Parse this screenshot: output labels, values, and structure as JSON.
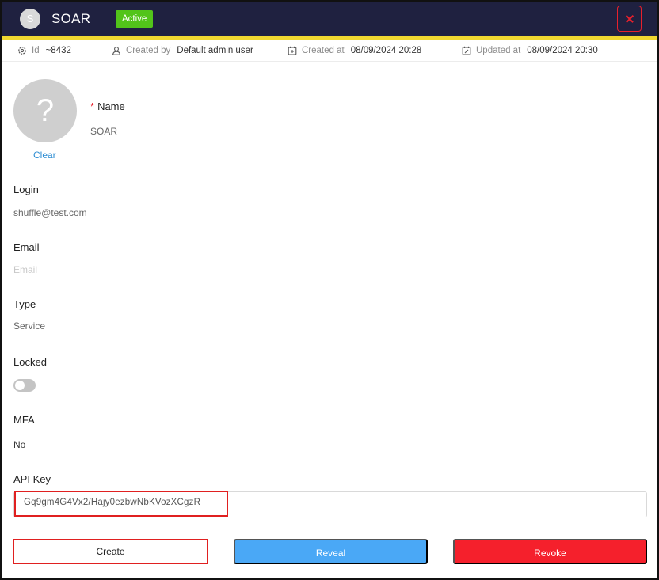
{
  "header": {
    "avatar_letter": "S",
    "title": "SOAR",
    "status": "Active",
    "close_icon": "close-icon",
    "colors": {
      "bar": "#1f2140",
      "stripe": "#f0d830",
      "status": "#52c41a",
      "close": "#e8202c"
    }
  },
  "meta": {
    "id_label": "Id",
    "id_value": "~8432",
    "created_by_label": "Created by",
    "created_by_value": "Default admin user",
    "created_at_label": "Created at",
    "created_at_value": "08/09/2024 20:28",
    "updated_at_label": "Updated at",
    "updated_at_value": "08/09/2024 20:30"
  },
  "avatar": {
    "placeholder": "?",
    "clear_label": "Clear"
  },
  "fields": {
    "name_label": "Name",
    "name_required": "*",
    "name_value": "SOAR",
    "login_label": "Login",
    "login_value": "shuffle@test.com",
    "email_label": "Email",
    "email_placeholder": "Email",
    "type_label": "Type",
    "type_value": "Service",
    "locked_label": "Locked",
    "locked_value": false,
    "mfa_label": "MFA",
    "mfa_value": "No",
    "api_key_label": "API Key",
    "api_key_value": "Gq9gm4G4Vx2/Hajy0ezbwNbKVozXCgzR"
  },
  "buttons": {
    "create": "Create",
    "reveal": "Reveal",
    "revoke": "Revoke",
    "colors": {
      "reveal": "#4aa8f6",
      "revoke": "#f5202c"
    }
  }
}
